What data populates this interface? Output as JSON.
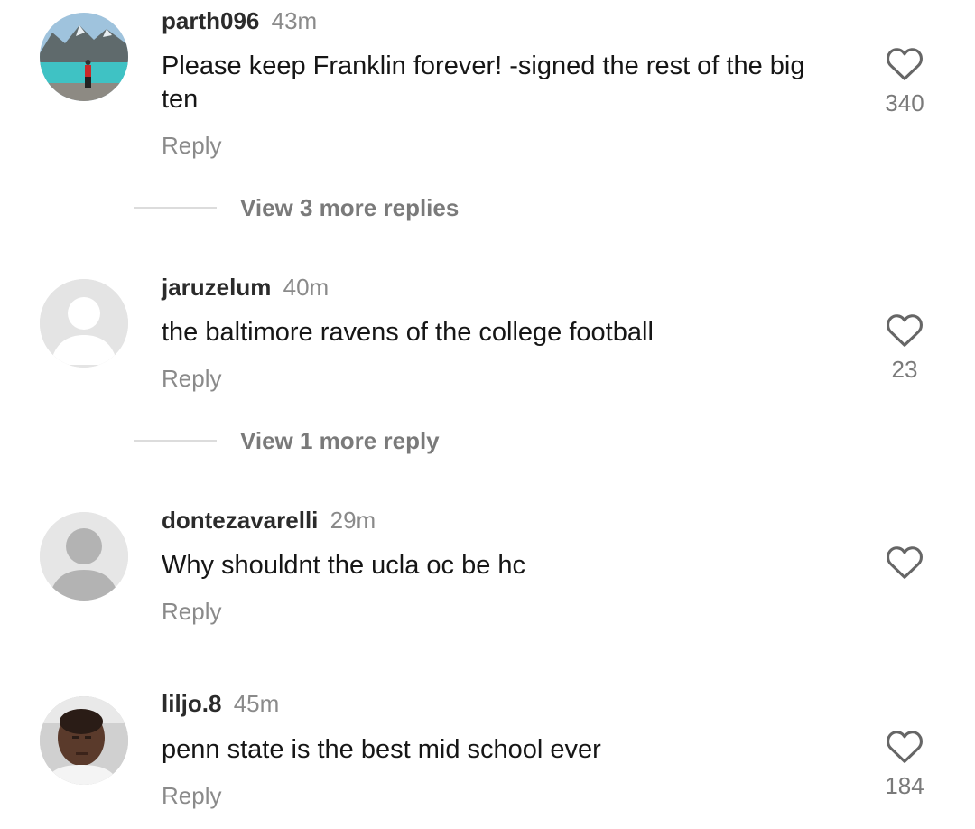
{
  "comments": [
    {
      "username": "parth096",
      "time": "43m",
      "text": "Please keep Franklin forever! -signed the rest of the big ten",
      "reply_label": "Reply",
      "likes": "340",
      "view_more": "View 3 more replies",
      "avatar": "landscape-photo"
    },
    {
      "username": "jaruzelum",
      "time": "40m",
      "text": "the baltimore ravens of the college football",
      "reply_label": "Reply",
      "likes": "23",
      "view_more": "View 1 more reply",
      "avatar": "default-avatar-light"
    },
    {
      "username": "dontezavarelli",
      "time": "29m",
      "text": "Why shouldnt the ucla oc be hc",
      "reply_label": "Reply",
      "likes": "",
      "avatar": "default-avatar"
    },
    {
      "username": "liljo.8",
      "time": "45m",
      "text": "penn state is the best mid school ever",
      "reply_label": "Reply",
      "likes": "184",
      "avatar": "person-photo"
    }
  ],
  "colors": {
    "username": "#2b2b2b",
    "secondary": "#8a8a8a",
    "text": "#161616",
    "heart_stroke": "#666666"
  },
  "icons": {
    "like": "heart-outline-icon"
  }
}
